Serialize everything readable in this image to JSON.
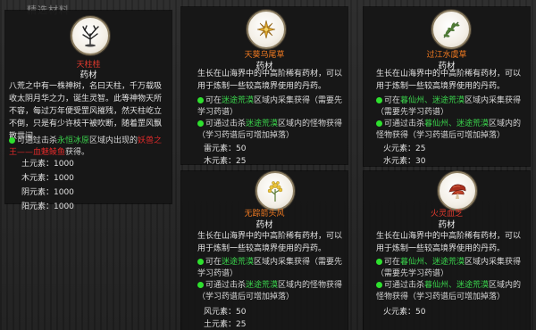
{
  "background_title": "精选材料",
  "card_tianzhu": {
    "name": "天柱桂",
    "type": "药材",
    "desc": "八荒之中有一株神树，名曰天柱，千万载吸收太阴月华之力，诞生灵智。此等神物天所不容，每过万年便受罡风摧残，然天柱屹立不倒，只是有少许枝干被吹断，随着罡风飘散世间。",
    "drop_prefix": "可通过击杀",
    "drop_place": "永恒冰原",
    "drop_mid": "区域内出现的",
    "drop_boss": "妖兽之王——血魅鲮鱼",
    "drop_suffix": "获得。",
    "stats": [
      "土元素：1000",
      "木元素：1000",
      "阴元素：1000",
      "阳元素：1000"
    ]
  },
  "card_tianfeng": {
    "name": "天葵乌尾草",
    "type": "药材",
    "desc": "生长在山海界中的中高阶稀有药材，可以用于炼制一些较高境界使用的丹药。",
    "gather_prefix": "可在",
    "gather_place": "迷途荒漠",
    "gather_suffix": "区域内采集获得（需要先学习药谱）",
    "kill_prefix": "可通过击杀",
    "kill_place": "迷途荒漠",
    "kill_suffix": "区域内的怪物获得（学习药谱后可增加掉落）",
    "stats": [
      "雷元素：50",
      "木元素：25"
    ]
  },
  "card_guojiang": {
    "name": "过江水虞草",
    "type": "药材",
    "desc": "生长在山海界中的中高阶稀有药材，可以用于炼制一些较高境界使用的丹药。",
    "gather_prefix": "可在",
    "gather_place": "暮仙州、迷途荒漠",
    "gather_suffix": "区域内采集获得（需要先学习药谱）",
    "kill_prefix": "可通过击杀",
    "kill_place": "暮仙州、迷途荒漠",
    "kill_suffix": "区域内的怪物获得（学习药谱后可增加掉落）",
    "stats": [
      "火元素：25",
      "水元素：30"
    ]
  },
  "card_wuzong": {
    "name": "无踪箭头风",
    "type": "药材",
    "desc": "生长在山海界中的中高阶稀有药材，可以用于炼制一些较高境界使用的丹药。",
    "gather_prefix": "可在",
    "gather_place": "迷途荒漠",
    "gather_suffix": "区域内采集获得（需要先学习药谱）",
    "kill_prefix": "可通过击杀",
    "kill_place": "迷途荒漠",
    "kill_suffix": "区域内的怪物获得（学习药谱后可增加掉落）",
    "stats": [
      "风元素：50",
      "土元素：25"
    ]
  },
  "card_huoling": {
    "name": "火灵血芝",
    "type": "药材",
    "desc": "生长在山海界中的中高阶稀有药材，可以用于炼制一些较高境界使用的丹药。",
    "gather_prefix": "可在",
    "gather_place": "暮仙州、迷途荒漠",
    "gather_suffix": "区域内采集获得（需要先学习药谱）",
    "kill_prefix": "可通过击杀",
    "kill_place": "暮仙州、迷途荒漠",
    "kill_suffix": "区域内的怪物获得（学习药谱后可增加掉落）",
    "stats": [
      "火元素：50"
    ]
  },
  "colors": {
    "name_red": "#e03a2e",
    "name_orange": "#f07a22",
    "green_text": "#39d04b",
    "red_text": "#e02a2a"
  }
}
